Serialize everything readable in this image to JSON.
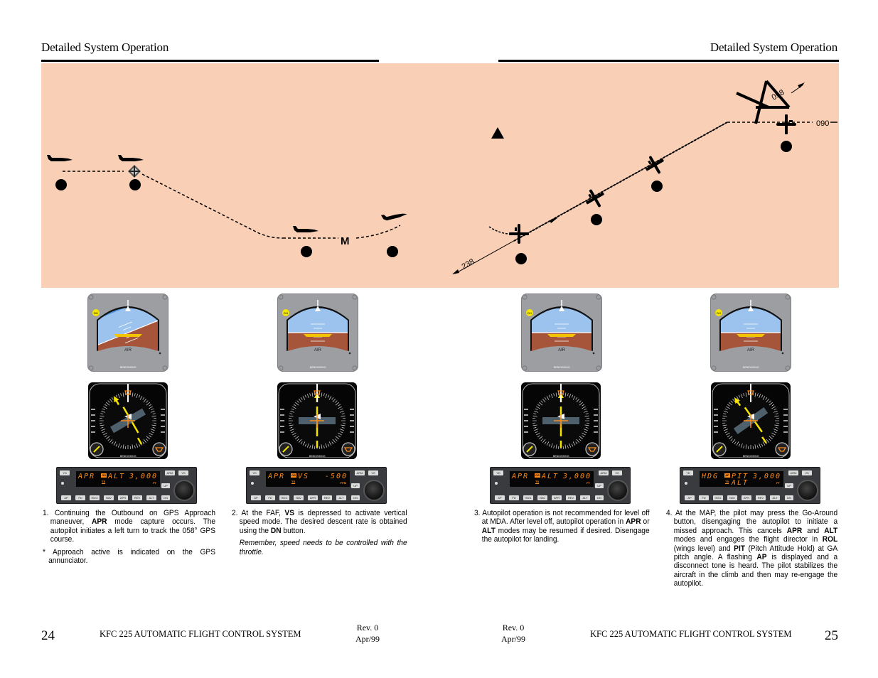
{
  "header": {
    "left_title": "Detailed System Operation",
    "right_title": "Detailed System Operation"
  },
  "diagram": {
    "background_color": "#f9cfb6",
    "left_panel": {
      "map_marker_label": "M",
      "waypoint_icon": "gps-waypoint-icon"
    },
    "right_panel": {
      "course_labels": [
        "238",
        "058",
        "090"
      ]
    }
  },
  "panels": [
    {
      "id": 1,
      "autopilot": {
        "top_left_button": "YD",
        "lateral_mode": "APR",
        "annunciator": "GS",
        "annunciator2": "TS",
        "vertical_mode": "ALT",
        "value": "3,000",
        "unit": "FT",
        "buttons_top": [
          "ARM",
          "VS"
        ],
        "buttons_bottom": [
          "AP",
          "FD",
          "HDG",
          "NAV",
          "APR",
          "REV",
          "ALT"
        ],
        "updown": [
          "UP",
          "DN"
        ]
      },
      "text": {
        "num": "1.",
        "body_parts": [
          {
            "t": "Continuing the Outbound on GPS Approach maneuver, "
          },
          {
            "b": "APR"
          },
          {
            "t": " mode capture occurs. The autopilot initiates a left turn to track the 058° GPS course."
          }
        ],
        "note": "* Approach active is indicated on the GPS annunciator."
      }
    },
    {
      "id": 2,
      "autopilot": {
        "top_left_button": "YD",
        "lateral_mode": "APR",
        "annunciator": "GS",
        "annunciator2": "TS",
        "vertical_mode": "VS",
        "value": "-500",
        "unit": "FPM",
        "buttons_top": [
          "ARM",
          "VS"
        ],
        "buttons_bottom": [
          "AP",
          "FD",
          "HDG",
          "NAV",
          "APR",
          "REV",
          "ALT"
        ],
        "updown": [
          "UP",
          "DN"
        ]
      },
      "text": {
        "num": "2.",
        "body_parts": [
          {
            "t": "At the FAF, "
          },
          {
            "b": "VS"
          },
          {
            "t": " is depressed to activate vertical speed mode. The desired descent rate is obtained using the "
          },
          {
            "b": "DN"
          },
          {
            "t": " button."
          }
        ],
        "italic": "Remember, speed needs to be controlled with the throttle."
      }
    },
    {
      "id": 3,
      "autopilot": {
        "top_left_button": "YD",
        "lateral_mode": "APR",
        "annunciator": "GS",
        "annunciator2": "TS",
        "vertical_mode": "ALT",
        "value": "3,000",
        "unit": "FT",
        "buttons_top": [
          "ARM",
          "VS"
        ],
        "buttons_bottom": [
          "AP",
          "FD",
          "HDG",
          "NAV",
          "APR",
          "REV",
          "ALT"
        ],
        "updown": [
          "UP",
          "DN"
        ]
      },
      "text": {
        "num": "3.",
        "body_parts": [
          {
            "t": "Autopilot operation is not recommended for level off at MDA. After level off, autopilot operation in "
          },
          {
            "b": "APR"
          },
          {
            "t": " or "
          },
          {
            "b": "ALT"
          },
          {
            "t": " modes may be resumed if desired. Disengage the autopilot for landing."
          }
        ]
      }
    },
    {
      "id": 4,
      "autopilot": {
        "top_left_button": "YD",
        "lateral_mode": "HDG",
        "annunciator": "AP",
        "annunciator2": "TS",
        "vertical_mode": "PIT",
        "vertical_mode2": "ALT",
        "value": "3,000",
        "unit": "FT",
        "buttons_top": [
          "ARM",
          "VS"
        ],
        "buttons_bottom": [
          "AP",
          "FD",
          "HDG",
          "NAV",
          "APR",
          "REV",
          "ALT"
        ],
        "updown": [
          "UP",
          "DN"
        ]
      },
      "text": {
        "num": "4.",
        "body_parts": [
          {
            "t": "At the MAP, the pilot may press the Go-Around button, disengaging the autopilot to initiate a missed approach. This cancels "
          },
          {
            "b": "APR"
          },
          {
            "t": " and "
          },
          {
            "b": "ALT"
          },
          {
            "t": " modes and engages the flight director in "
          },
          {
            "b": "ROL"
          },
          {
            "t": " (wings level) and "
          },
          {
            "b": "PIT"
          },
          {
            "t": " (Pitch Attitude Hold) at GA pitch angle. A flashing "
          },
          {
            "b": "AP"
          },
          {
            "t": " is displayed and a disconnect tone is heard. The pilot stabilizes the aircraft in the climb and then may re-engage the autopilot."
          }
        ]
      }
    }
  ],
  "instrument_labels": {
    "ai_center": "AIR",
    "ai_badge": "DH",
    "brand": "BENDIX/KING"
  },
  "footer": {
    "left_page": "24",
    "right_page": "25",
    "left_title": "KFC 225 AUTOMATIC FLIGHT CONTROL  SYSTEM",
    "right_title": "KFC 225 AUTOMATIC FLIGHT CONTROL  SYSTEM",
    "left_rev": "Rev. 0",
    "left_date": "Apr/99",
    "right_rev": "Rev. 0",
    "right_date": "Apr/99"
  }
}
